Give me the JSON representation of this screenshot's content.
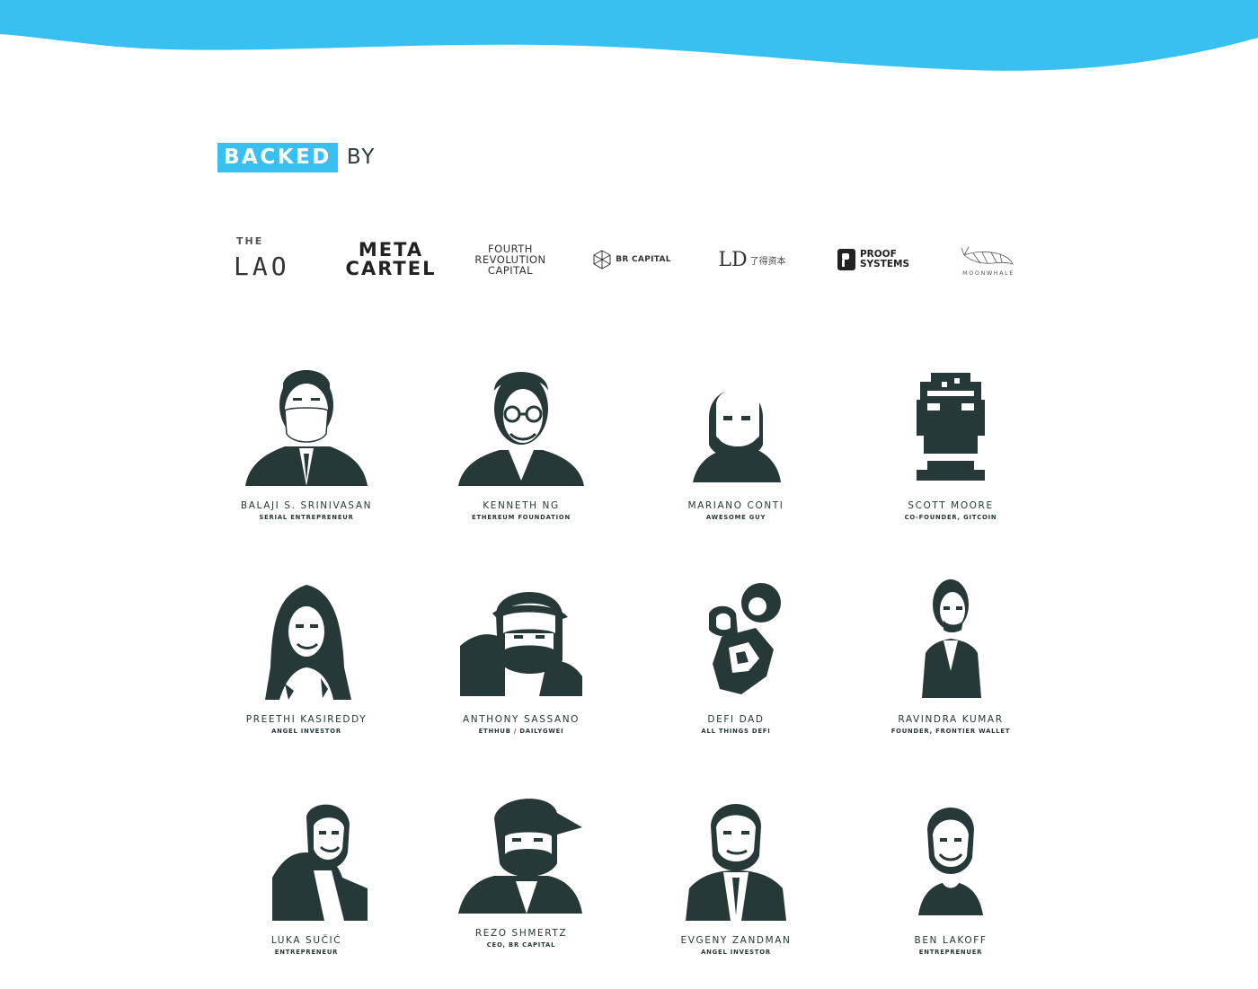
{
  "colors": {
    "accent": "#38c1f0",
    "ink": "#263838"
  },
  "heading": {
    "highlight": "BACKED",
    "rest": "BY"
  },
  "logos": [
    {
      "id": "the-lao",
      "lines": [
        "THE",
        "LAO"
      ]
    },
    {
      "id": "metacartel",
      "lines": [
        "META",
        "CARTEL"
      ]
    },
    {
      "id": "fourth-revolution-capital",
      "lines": [
        "FOURTH",
        "REVOLUTION",
        "CAPITAL"
      ]
    },
    {
      "id": "br-capital",
      "lines": [
        "BR CAPITAL"
      ]
    },
    {
      "id": "ld-capital",
      "lines": [
        "LD",
        "了得资本"
      ]
    },
    {
      "id": "proof-systems",
      "lines": [
        "PROOF",
        "SYSTEMS"
      ]
    },
    {
      "id": "moonwhale",
      "lines": [
        "MOONWHALE"
      ]
    }
  ],
  "backers": [
    {
      "name": "BALAJI S. SRINIVASAN",
      "role": "SERIAL ENTREPRENEUR"
    },
    {
      "name": "KENNETH NG",
      "role": "ETHEREUM FOUNDATION"
    },
    {
      "name": "MARIANO CONTI",
      "role": "AWESOME GUY"
    },
    {
      "name": "SCOTT MOORE",
      "role": "CO-FOUNDER, GITCOIN"
    },
    {
      "name": "PREETHI KASIREDDY",
      "role": "ANGEL INVESTOR"
    },
    {
      "name": "ANTHONY SASSANO",
      "role": "ETHHUB / DAILYGWEI"
    },
    {
      "name": "DEFI DAD",
      "role": "ALL THINGS DEFI"
    },
    {
      "name": "RAVINDRA KUMAR",
      "role": "FOUNDER, FRONTIER WALLET"
    },
    {
      "name": "LUKA SUČIĆ",
      "role": "ENTREPRENEUR"
    },
    {
      "name": "REZO SHMERTZ",
      "role": "CEO, BR CAPITAL"
    },
    {
      "name": "EVGENY ZANDMAN",
      "role": "ANGEL INVESTOR"
    },
    {
      "name": "BEN LAKOFF",
      "role": "ENTREPRENUER"
    }
  ]
}
